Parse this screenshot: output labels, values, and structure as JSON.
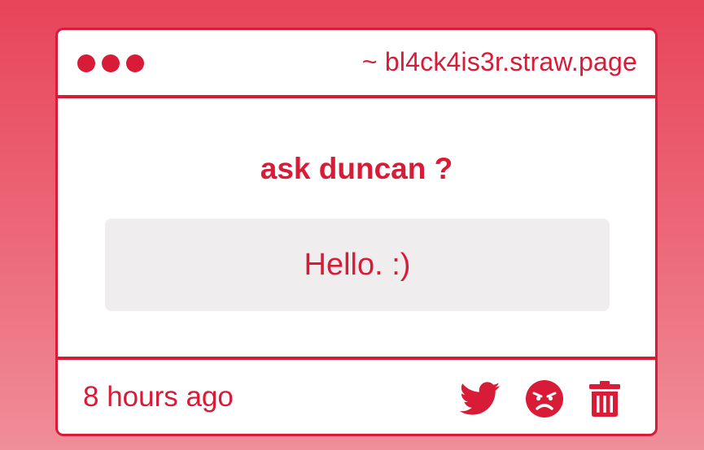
{
  "window": {
    "url": "~ bl4ck4is3r.straw.page",
    "controls": [
      "dot-1",
      "dot-2",
      "dot-3"
    ]
  },
  "post": {
    "question": "ask duncan ?",
    "answer": "Hello. :)"
  },
  "footer": {
    "time": "8 hours ago",
    "actions": [
      {
        "icon": "twitter-icon"
      },
      {
        "icon": "angry-face-icon"
      },
      {
        "icon": "trash-icon"
      }
    ]
  },
  "colors": {
    "accent": "#d81b37",
    "answer_bg": "#efeded",
    "page_bg_top": "#e8445a",
    "page_bg_bottom": "#f08e99"
  }
}
